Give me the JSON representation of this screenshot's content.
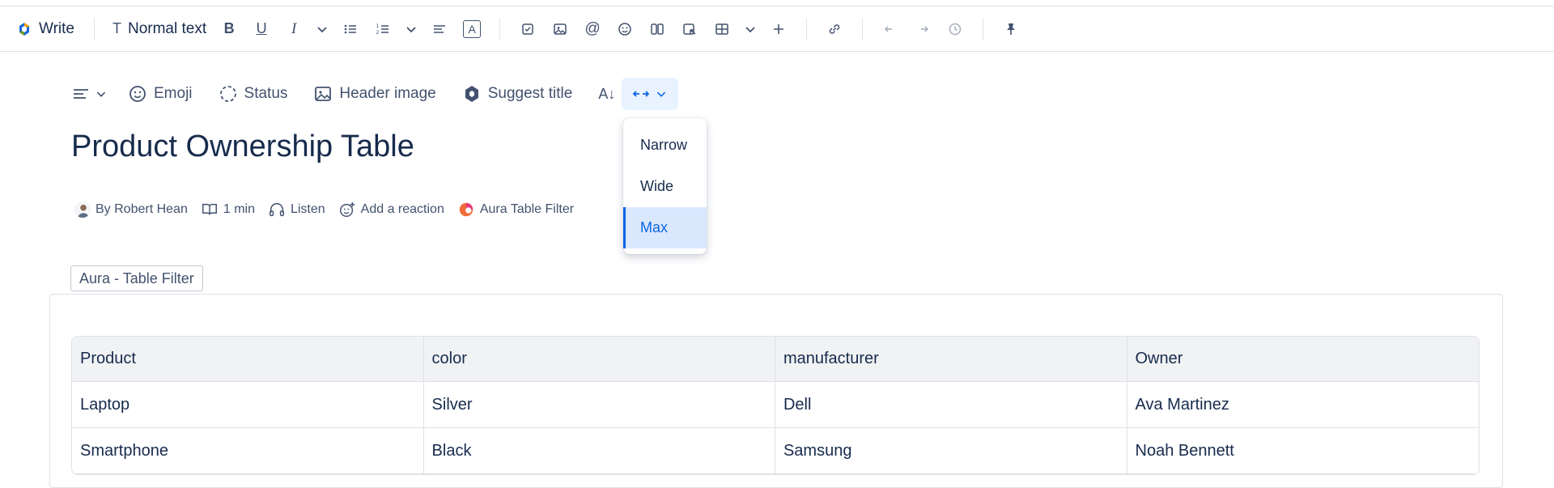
{
  "toolbar": {
    "write_label": "Write",
    "text_style_label": "Normal text",
    "text_style_icon": "T",
    "color_letter": "A"
  },
  "subbar": {
    "emoji_label": "Emoji",
    "status_label": "Status",
    "header_image_label": "Header image",
    "suggest_title_label": "Suggest title",
    "font_size_glyph": "A↓"
  },
  "width_menu": {
    "options": [
      "Narrow",
      "Wide",
      "Max"
    ],
    "selected": "Max"
  },
  "page": {
    "title": "Product Ownership Table"
  },
  "byline": {
    "author": "By Robert Hean",
    "read_time": "1 min",
    "listen_label": "Listen",
    "reaction_label": "Add a reaction",
    "app_label": "Aura Table Filter"
  },
  "macro": {
    "tag_label": "Aura - Table Filter"
  },
  "table": {
    "headers": [
      "Product",
      "color",
      "manufacturer",
      "Owner"
    ],
    "rows": [
      [
        "Laptop",
        "Silver",
        "Dell",
        "Ava Martinez"
      ],
      [
        "Smartphone",
        "Black",
        "Samsung",
        "Noah Bennett"
      ]
    ]
  },
  "colors": {
    "accent": "#0c66e4",
    "selected_bg": "#dbe7fd",
    "text": "#172b4d",
    "subtle": "#42526e"
  }
}
